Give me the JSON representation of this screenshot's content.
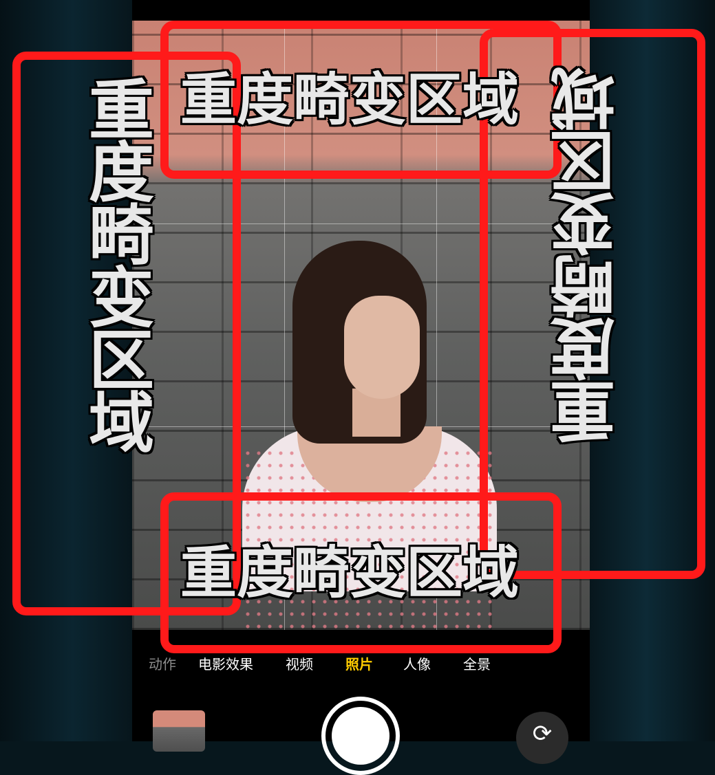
{
  "overlay": {
    "top_label": "重度畸变区域",
    "bottom_label": "重度畸变区域",
    "left_label": "重度畸变区域",
    "right_label": "重度畸变区域",
    "box_color": "#ff1a1a"
  },
  "camera": {
    "modes": [
      "慢动作",
      "电影效果",
      "视频",
      "照片",
      "人像",
      "全景"
    ],
    "visible_modes": [
      "动作",
      "电影效果",
      "视频",
      "照片",
      "人像",
      "全景"
    ],
    "active_mode": "照片",
    "active_color": "#ffcc00",
    "icons": {
      "shutter": "shutter-icon",
      "flip": "camera-flip-icon",
      "thumbnail": "photo-thumbnail-icon"
    }
  }
}
